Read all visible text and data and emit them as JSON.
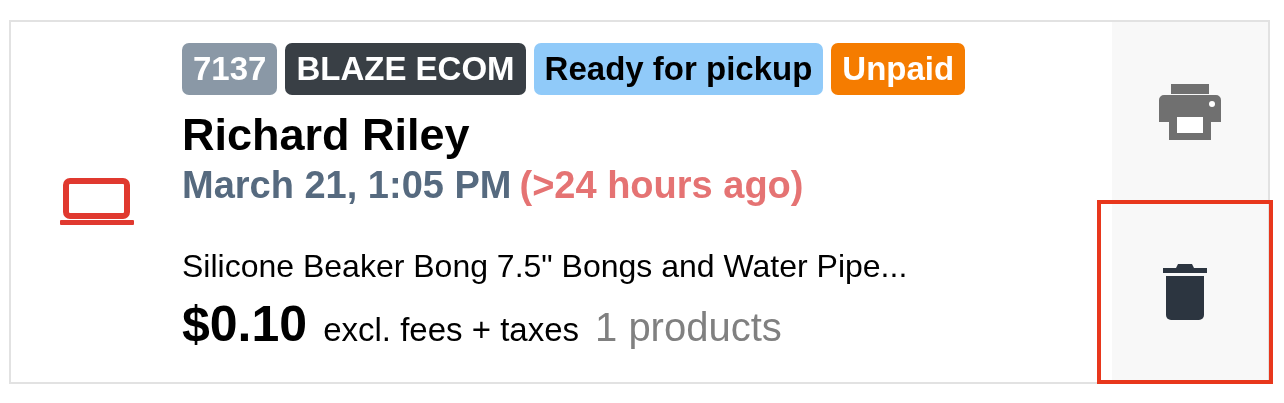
{
  "order": {
    "badges": [
      {
        "text": "7137",
        "color": "#8a98a6"
      },
      {
        "text": "BLAZE ECOM",
        "color": "#393f45"
      },
      {
        "text": "Ready for pickup",
        "color": "#90caf9"
      },
      {
        "text": "Unpaid",
        "color": "#f57c00"
      }
    ],
    "customer": "Richard Riley",
    "date": "March 21, 1:05 PM",
    "age": "(>24 hours ago)",
    "product": "Silicone Beaker Bong 7.5\" Bongs and Water Pipe...",
    "price": "$0.10",
    "price_note": "excl. fees + taxes",
    "count": "1 products",
    "actions": [
      {
        "kind": "print",
        "highlighted": false
      },
      {
        "kind": "delete",
        "highlighted": true
      }
    ]
  }
}
